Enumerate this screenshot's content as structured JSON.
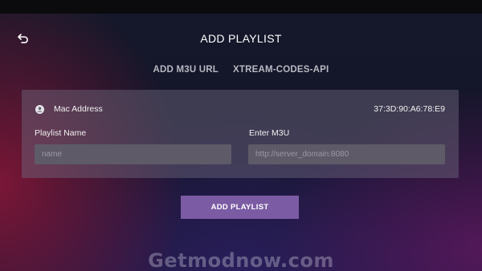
{
  "header": {
    "title": "ADD PLAYLIST",
    "back_icon": "back-arrow-icon"
  },
  "tabs": [
    {
      "label": "ADD M3U URL"
    },
    {
      "label": "XTREAM-CODES-API"
    }
  ],
  "mac": {
    "icon": "user-circle-icon",
    "label": "Mac Address",
    "value": "37:3D:90:A6:78:E9"
  },
  "form": {
    "playlist_name_label": "Playlist Name",
    "playlist_name_placeholder": "name",
    "playlist_name_value": "",
    "m3u_label": "Enter M3U",
    "m3u_placeholder": "http://server_domain:8080",
    "m3u_value": ""
  },
  "actions": {
    "add_label": "ADD PLAYLIST"
  },
  "watermark": "Getmodnow.com",
  "colors": {
    "accent": "#7b5ba3",
    "card": "#706a80",
    "input": "#5e5a68"
  }
}
